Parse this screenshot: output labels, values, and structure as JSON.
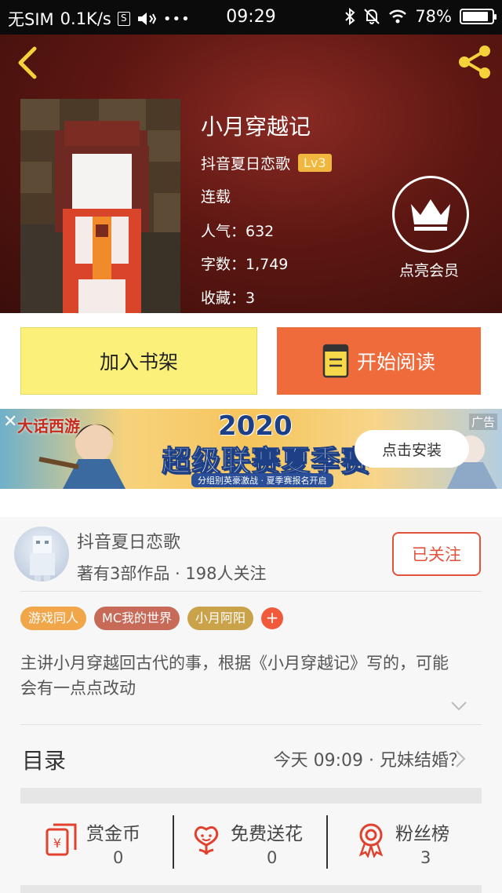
{
  "status_bar": {
    "carrier": "无SIM",
    "speed": "0.1K/s",
    "sim_icon_text": "S",
    "time": "09:29",
    "battery": "78%",
    "battery_level": 0.78
  },
  "book": {
    "title": "小月穿越记",
    "author": "抖音夏日恋歌",
    "author_level": "Lv3",
    "status": "连载",
    "popularity": "人气：632",
    "word_count": "字数：1,749",
    "favorites": "收藏：3",
    "vip_label": "点亮会员"
  },
  "actions": {
    "add_shelf": "加入书架",
    "start_reading": "开始阅读"
  },
  "ad": {
    "game_name": "大话西游",
    "tag": "广告",
    "year": "2020",
    "headline": "超级联赛夏季赛",
    "subline": "分组别英豪激战 · 夏季赛报名开启",
    "install": "点击安装",
    "close": "✕"
  },
  "author_card": {
    "name": "抖音夏日恋歌",
    "stats": "著有3部作品 · 198人关注",
    "follow": "已关注",
    "tags": [
      {
        "label": "游戏同人",
        "color": "#f2a64a"
      },
      {
        "label": "MC我的世界",
        "color": "#c86a58"
      },
      {
        "label": "小月阿阳",
        "color": "#caa24a"
      }
    ],
    "tag_add": "+",
    "description": "主讲小月穿越回古代的事，根据《小月穿越记》写的，可能会有一点点改动"
  },
  "toc": {
    "label": "目录",
    "latest": "今天 09:09 · 兄妹结婚？"
  },
  "stats": [
    {
      "label": "赏金币",
      "value": "0",
      "icon": "money-envelope-icon"
    },
    {
      "label": "免费送花",
      "value": "0",
      "icon": "flower-icon"
    },
    {
      "label": "粉丝榜",
      "value": "3",
      "icon": "award-ribbon-icon"
    }
  ],
  "colors": {
    "accent_orange": "#ef6b3c",
    "shelf_yellow": "#fbf07a",
    "follow_red": "#e2523a",
    "header_red": "#5e1712",
    "level_gold": "#f1b640"
  }
}
